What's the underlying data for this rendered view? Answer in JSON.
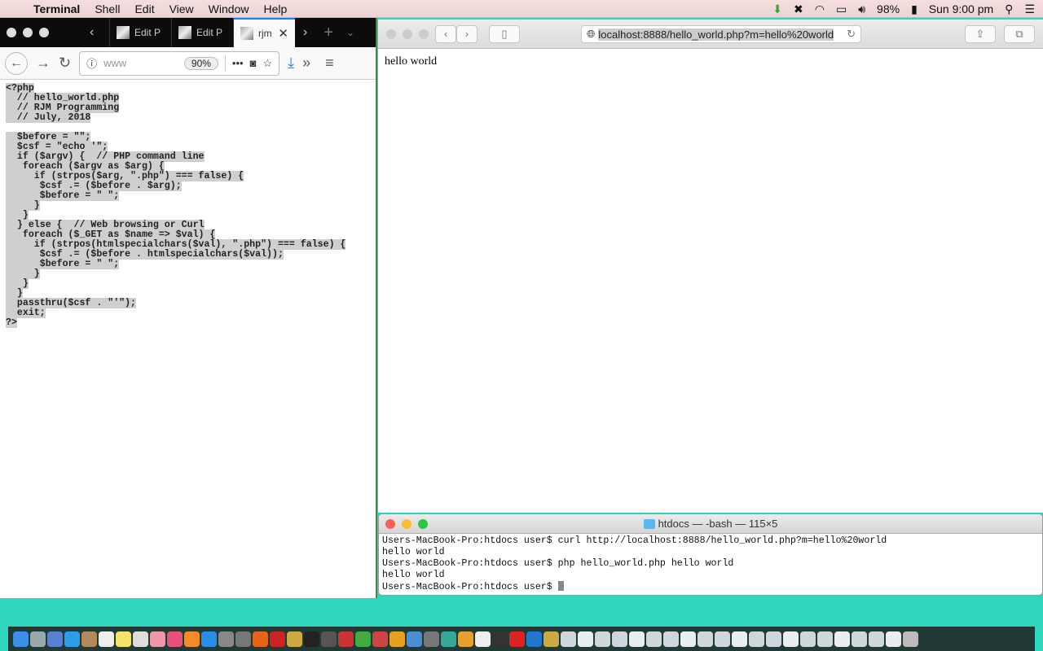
{
  "menubar": {
    "app": "Terminal",
    "items": [
      "Shell",
      "Edit",
      "View",
      "Window",
      "Help"
    ],
    "battery": "98%",
    "clock": "Sun 9:00 pm"
  },
  "firefox": {
    "tabs": [
      {
        "label": "Edit P"
      },
      {
        "label": "Edit P"
      },
      {
        "label": "rjm"
      }
    ],
    "url": "www",
    "zoom": "90%",
    "code": [
      "<?php",
      "  // hello_world.php",
      "  // RJM Programming",
      "  // July, 2018",
      "",
      "  $before = \"\";",
      "  $csf = \"echo '\";",
      "  if ($argv) {  // PHP command line",
      "   foreach ($argv as $arg) {",
      "     if (strpos($arg, \".php\") === false) {",
      "      $csf .= ($before . $arg);",
      "      $before = \" \";",
      "     }",
      "   }",
      "  } else {  // Web browsing or Curl",
      "   foreach ($_GET as $name => $val) {",
      "     if (strpos(htmlspecialchars($val), \".php\") === false) {",
      "      $csf .= ($before . htmlspecialchars($val));",
      "      $before = \" \";",
      "     }",
      "   }",
      "  }",
      "  passthru($csf . \"'\");",
      "  exit;",
      "?>"
    ]
  },
  "safari": {
    "url": "localhost:8888/hello_world.php?m=hello%20world",
    "body": "hello world"
  },
  "terminal": {
    "title": "htdocs — -bash — 115×5",
    "lines": [
      "Users-MacBook-Pro:htdocs user$ curl http://localhost:8888/hello_world.php?m=hello%20world",
      "hello world",
      "Users-MacBook-Pro:htdocs user$ php hello_world.php hello world",
      "hello world",
      "Users-MacBook-Pro:htdocs user$ "
    ]
  },
  "dock": {
    "icons": [
      "finder",
      "launchpad",
      "safari",
      "mail",
      "contacts",
      "calendar",
      "notes",
      "reminders",
      "photos",
      "itunes",
      "books",
      "app-store",
      "system-preferences",
      "textwrangler",
      "firefox",
      "filezilla",
      "terminal",
      "activity",
      "chrome",
      "skype",
      "maps",
      "preview",
      "xcode",
      "vscode",
      "opera",
      "misc",
      "misc",
      "misc",
      "misc",
      "misc",
      "misc",
      "misc",
      "misc",
      "misc",
      "misc",
      "misc",
      "misc",
      "misc",
      "misc",
      "misc",
      "misc",
      "misc",
      "misc",
      "misc",
      "misc",
      "misc",
      "misc",
      "misc",
      "misc",
      "misc",
      "misc",
      "misc",
      "trash"
    ]
  }
}
